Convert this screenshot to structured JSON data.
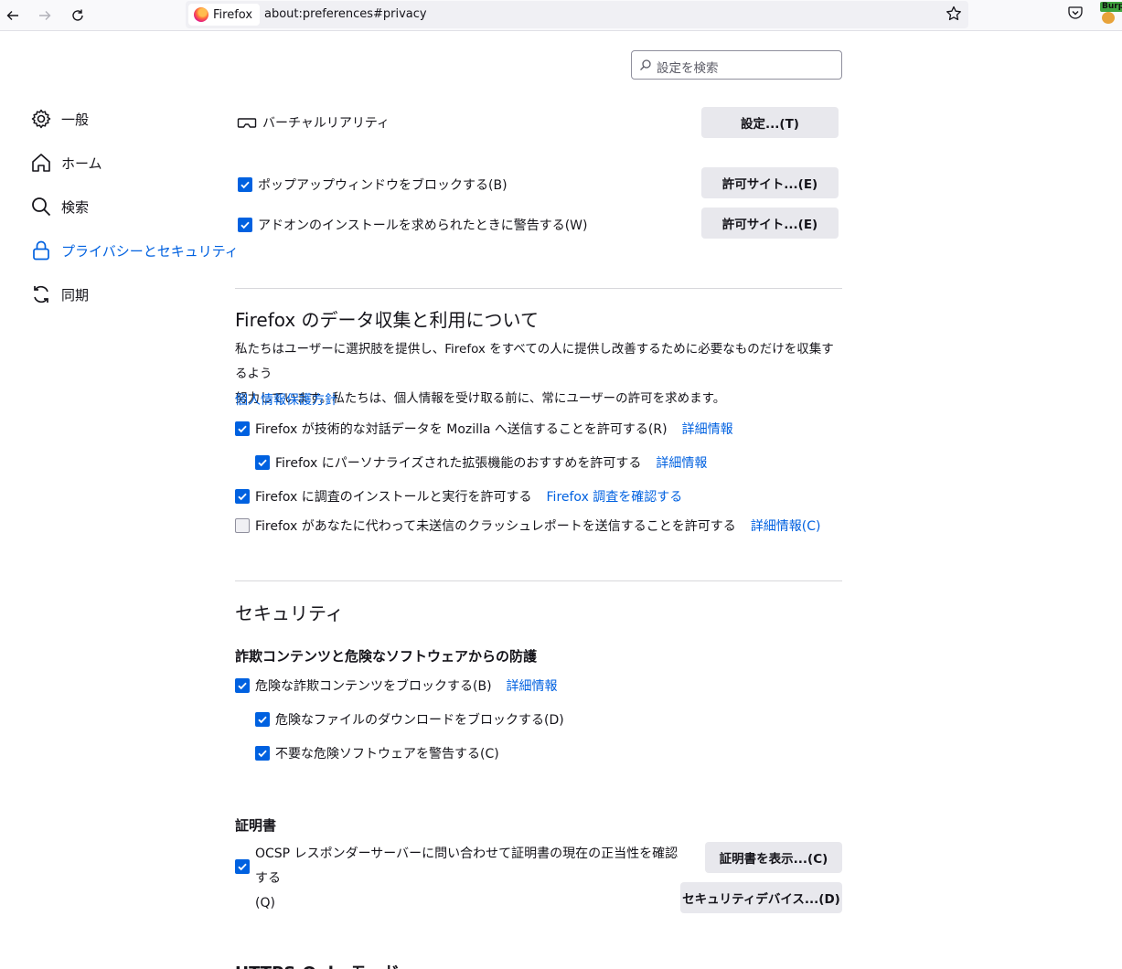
{
  "browser": {
    "tab_title": "Firefox",
    "url": "about:preferences#privacy",
    "ext_badge": "Burp"
  },
  "search": {
    "placeholder": "設定を検索"
  },
  "sidebar": {
    "items": [
      {
        "label": "一般",
        "icon": "gear-icon"
      },
      {
        "label": "ホーム",
        "icon": "home-icon"
      },
      {
        "label": "検索",
        "icon": "search-icon"
      },
      {
        "label": "プライバシーとセキュリティ",
        "icon": "lock-icon",
        "active": true
      },
      {
        "label": "同期",
        "icon": "sync-icon"
      }
    ]
  },
  "permissions": {
    "vr_label": "バーチャルリアリティ",
    "vr_button": "設定...(T)",
    "popup_label": "ポップアップウィンドウをブロックする(B)",
    "popup_checked": true,
    "popup_button": "許可サイト...(E)",
    "addon_label": "アドオンのインストールを求められたときに警告する(W)",
    "addon_checked": true,
    "addon_button": "許可サイト...(E)"
  },
  "data_collection": {
    "heading": "Firefox のデータ収集と利用について",
    "description_1": "私たちはユーザーに選択肢を提供し、Firefox をすべての人に提供し改善するために必要なものだけを収集するよう",
    "description_2": "努力しています。私たちは、個人情報を受け取る前に、常にユーザーの許可を求めます。",
    "privacy_link": "個人情報保護方針",
    "tech_label": "Firefox が技術的な対話データを Mozilla へ送信することを許可する(R)",
    "tech_link": "詳細情報",
    "tech_checked": true,
    "ext_rec_label": "Firefox にパーソナライズされた拡張機能のおすすめを許可する",
    "ext_rec_link": "詳細情報",
    "ext_rec_checked": true,
    "studies_label": "Firefox に調査のインストールと実行を許可する",
    "studies_link": "Firefox 調査を確認する",
    "studies_checked": true,
    "crash_label": "Firefox があなたに代わって未送信のクラッシュレポートを送信することを許可する",
    "crash_link": "詳細情報(C)",
    "crash_checked": false
  },
  "security": {
    "heading": "セキュリティ",
    "subheading": "詐欺コンテンツと危険なソフトウェアからの防護",
    "block_label": "危険な詐欺コンテンツをブロックする(B)",
    "block_link": "詳細情報",
    "block_checked": true,
    "downloads_label": "危険なファイルのダウンロードをブロックする(D)",
    "downloads_checked": true,
    "unwanted_label": "不要な危険ソフトウェアを警告する(C)",
    "unwanted_checked": true
  },
  "certificates": {
    "heading": "証明書",
    "ocsp_label_1": "OCSP レスポンダーサーバーに問い合わせて証明書の現在の正当性を確認する",
    "ocsp_label_2": "(Q)",
    "ocsp_checked": true,
    "view_button": "証明書を表示...(C)",
    "devices_button": "セキュリティデバイス...(D)"
  },
  "next_heading": "HTTPS-Only モード"
}
